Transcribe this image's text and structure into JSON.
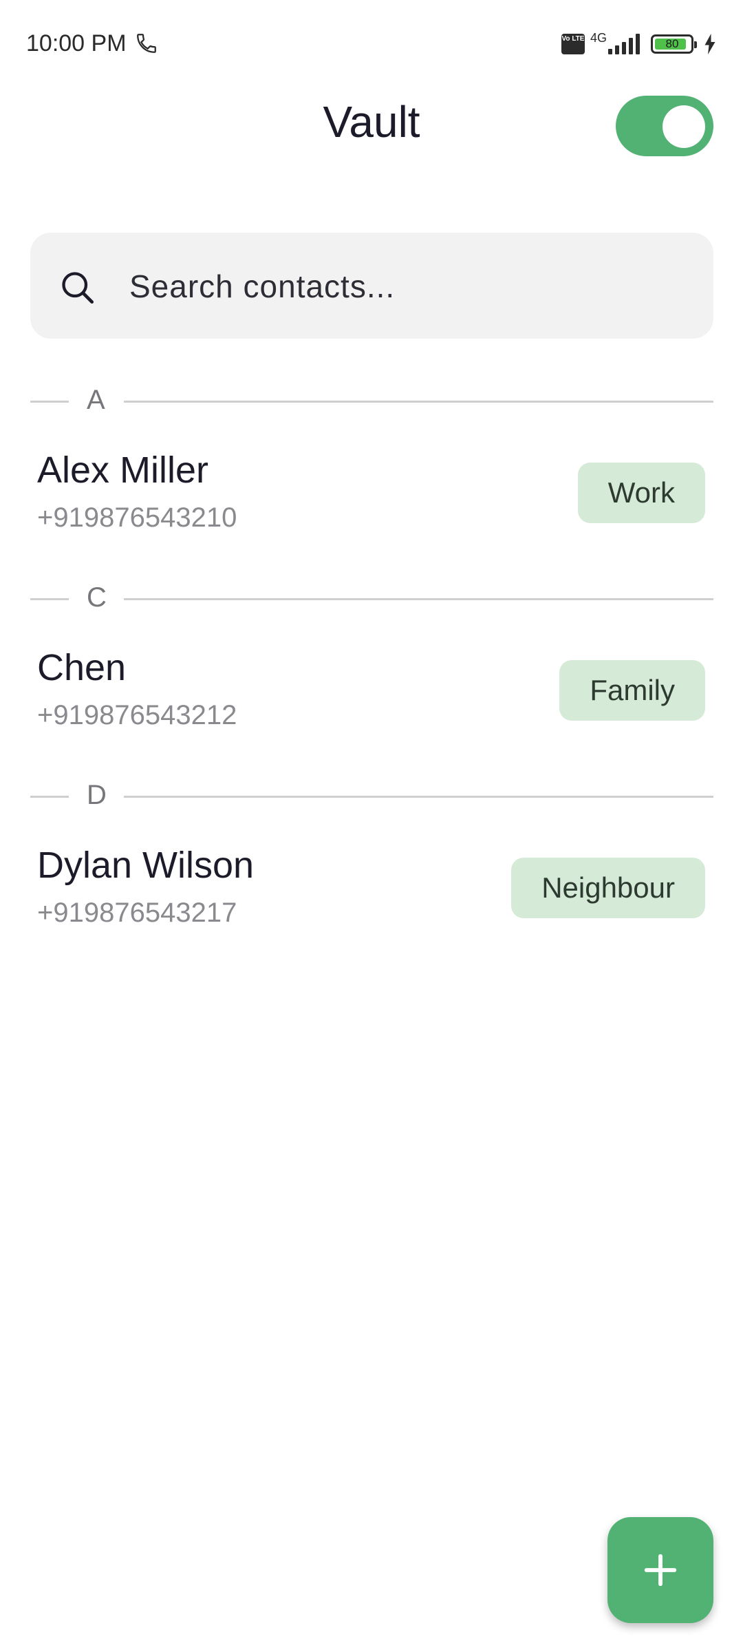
{
  "status_bar": {
    "time": "10:00 PM",
    "network": "4G",
    "volte": "Vo LTE",
    "battery": "80"
  },
  "header": {
    "title": "Vault",
    "toggle_on": true
  },
  "search": {
    "placeholder": "Search contacts..."
  },
  "sections": [
    {
      "letter": "A",
      "contacts": [
        {
          "name": "Alex Miller",
          "phone": "+919876543210",
          "tag": "Work"
        }
      ]
    },
    {
      "letter": "C",
      "contacts": [
        {
          "name": "Chen",
          "phone": "+919876543212",
          "tag": "Family"
        }
      ]
    },
    {
      "letter": "D",
      "contacts": [
        {
          "name": "Dylan Wilson",
          "phone": "+919876543217",
          "tag": "Neighbour"
        }
      ]
    }
  ],
  "colors": {
    "accent": "#52b274",
    "tag_bg": "#d6ead8"
  }
}
